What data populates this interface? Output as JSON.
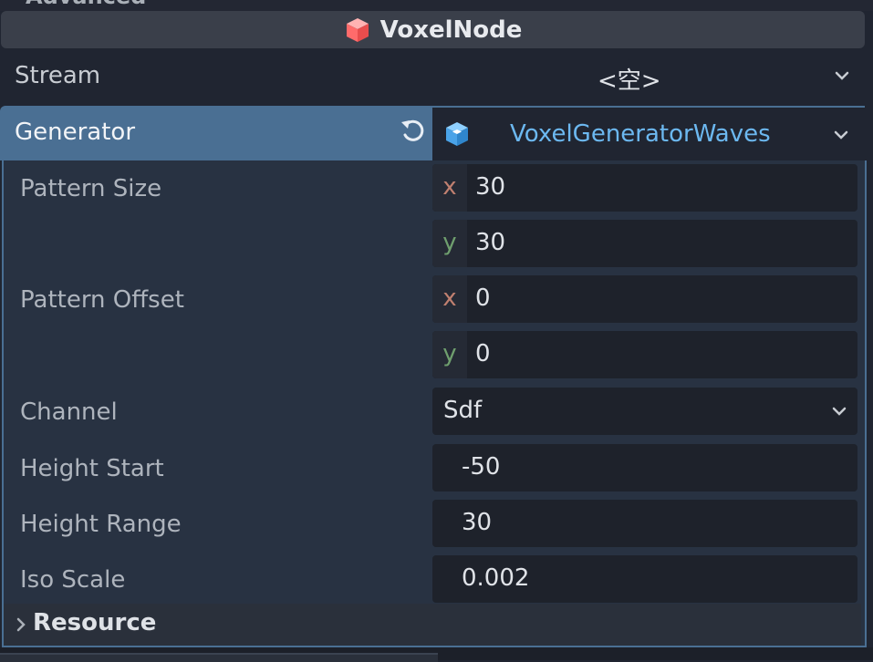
{
  "inspector": {
    "cut_header": "Advanced",
    "class_name": "VoxelNode",
    "stream": {
      "label": "Stream",
      "value": "<空>"
    },
    "generator": {
      "label": "Generator",
      "type": "VoxelGeneratorWaves"
    },
    "properties": {
      "pattern_size": {
        "label": "Pattern Size",
        "x": "30",
        "y": "30"
      },
      "pattern_offset": {
        "label": "Pattern Offset",
        "x": "0",
        "y": "0"
      },
      "channel": {
        "label": "Channel",
        "value": "Sdf"
      },
      "height_start": {
        "label": "Height Start",
        "value": "-50"
      },
      "height_range": {
        "label": "Height Range",
        "value": "30"
      },
      "iso_scale": {
        "label": "Iso Scale",
        "value": "0.002"
      }
    },
    "axis_labels": {
      "x": "x",
      "y": "y"
    },
    "resource_section": "Resource"
  },
  "icons": {
    "class_icon": "red-cube-icon",
    "reset": "revert-icon",
    "resource": "blue-cube-icon",
    "dropdown": "chevron-down-icon",
    "expand": "chevron-right-icon"
  },
  "colors": {
    "accent": "#4a6f93",
    "resource_link": "#6cb8f0",
    "axis_x": "#c08070",
    "axis_y": "#6f9f6e"
  }
}
